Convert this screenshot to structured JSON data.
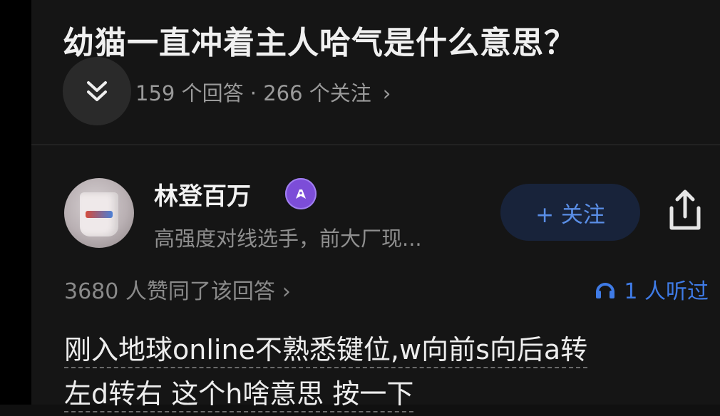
{
  "question": {
    "title": "幼猫一直冲着主人哈气是什么意思？",
    "stats": "159 个回答 · 266 个关注",
    "stats_chevron": "›"
  },
  "answer": {
    "author": {
      "name": "林登百万",
      "bio": "高强度对线选手，前大厂现..."
    },
    "follow_label": "+ 关注",
    "votes": "3680 人赞同了该回答",
    "votes_chevron": "›",
    "listened": "1 人听过",
    "text_line1": "刚入地球online不熟悉键位,w向前s向后a转",
    "text_line2": "左d转右 这个h啥意思 按一下"
  },
  "colors": {
    "background": "#151515",
    "accent": "#3f7be6",
    "badge": "#7c4dd8"
  },
  "icons": [
    "collapse-chevron-icon",
    "creator-badge-icon",
    "share-icon",
    "headphones-icon"
  ]
}
